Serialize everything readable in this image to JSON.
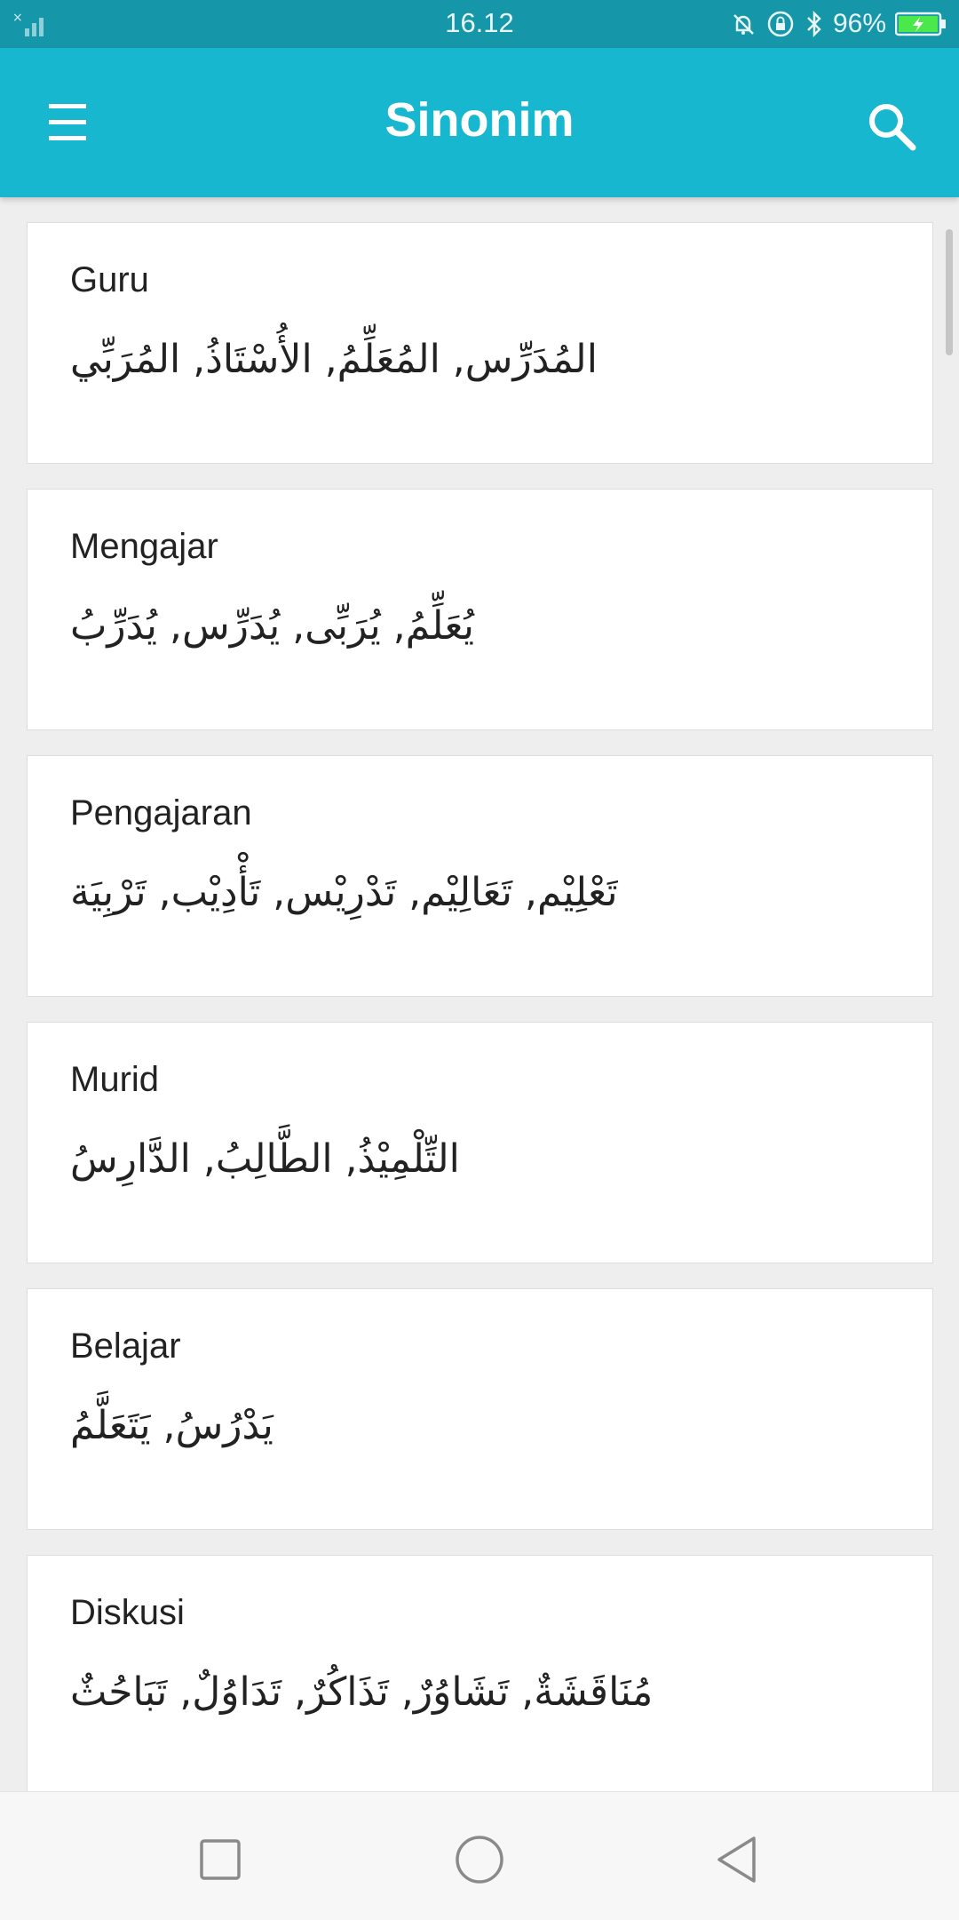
{
  "status_bar": {
    "time": "16.12",
    "battery": "96%"
  },
  "app_bar": {
    "title": "Sinonim",
    "menu_icon": "hamburger-menu-icon",
    "search_icon": "search-icon"
  },
  "entries": [
    {
      "word": "Guru",
      "synonyms": "المُدَرِّس, المُعَلِّمُ, الأُسْتَاذُ, المُرَبِّي"
    },
    {
      "word": "Mengajar",
      "synonyms": "يُعَلِّمُ, يُرَبِّى, يُدَرِّس, يُدَرِّبُ"
    },
    {
      "word": "Pengajaran",
      "synonyms": "تَعْلِيْم, تَعَالِيْم, تَدْرِيْس, تَأْدِيْب, تَرْبِيَة"
    },
    {
      "word": "Murid",
      "synonyms": "التِّلْمِيْذُ, الطَّالِبُ, الدَّارِسُ"
    },
    {
      "word": "Belajar",
      "synonyms": "يَدْرُسُ, يَتَعَلَّمُ"
    },
    {
      "word": "Diskusi",
      "synonyms": "مُنَاقَشَةٌ, تَشَاوُرٌ, تَذَاكُرٌ, تَدَاوُلٌ, تَبَاحُثٌ"
    }
  ],
  "colors": {
    "status_bar": "#1696a9",
    "app_bar": "#17b7cf",
    "background": "#eeeeee"
  }
}
